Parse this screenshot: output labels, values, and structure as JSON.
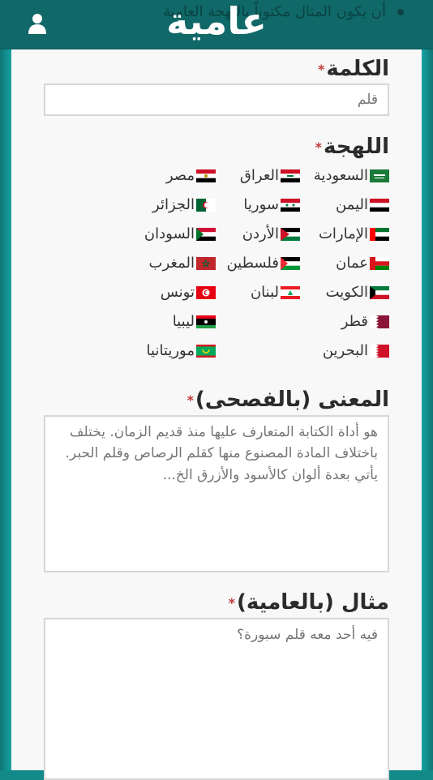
{
  "header": {
    "logo": "عامية",
    "background_text": "أن يكون المثال مكتوباً باللهجة العامية",
    "user_icon": "user-icon"
  },
  "word": {
    "label": "الكلمة",
    "required_mark": "*",
    "placeholder": "قلم"
  },
  "dialect": {
    "label": "اللهجة",
    "required_mark": "*",
    "options": [
      {
        "label": "السعودية",
        "flag": "flag-saudi"
      },
      {
        "label": "العراق",
        "flag": "flag-iraq"
      },
      {
        "label": "مصر",
        "flag": "flag-egypt"
      },
      {
        "label": "اليمن",
        "flag": "flag-yemen"
      },
      {
        "label": "سوريا",
        "flag": "flag-syria"
      },
      {
        "label": "الجزائر",
        "flag": "flag-algeria"
      },
      {
        "label": "الإمارات",
        "flag": "flag-uae"
      },
      {
        "label": "الأردن",
        "flag": "flag-jordan"
      },
      {
        "label": "السودان",
        "flag": "flag-sudan"
      },
      {
        "label": "عمان",
        "flag": "flag-oman"
      },
      {
        "label": "فلسطين",
        "flag": "flag-palestine"
      },
      {
        "label": "المغرب",
        "flag": "flag-morocco"
      },
      {
        "label": "الكويت",
        "flag": "flag-kuwait"
      },
      {
        "label": "لبنان",
        "flag": "flag-lebanon"
      },
      {
        "label": "تونس",
        "flag": "flag-tunisia"
      },
      {
        "label": "قطر",
        "flag": "flag-qatar"
      },
      {
        "label": "ليبيا",
        "flag": "flag-libya"
      },
      {
        "label": "البحرين",
        "flag": "flag-bahrain"
      },
      {
        "label": "موريتانيا",
        "flag": "flag-mauritania"
      }
    ]
  },
  "meaning": {
    "label": "المعنى (بالفصحى)",
    "required_mark": "*",
    "placeholder": "هو أداة الكتابة المتعارف عليها منذ قديم الزمان. يختلف باختلاف المادة المصنوع منها كقلم الرصاص وقلم الحبر. يأتي بعدة ألوان كالأسود والأزرق الخ..."
  },
  "example": {
    "label": "مثال (بالعامية)",
    "required_mark": "*",
    "placeholder": "فيه أحد معه قلم سبورة؟"
  },
  "colors": {
    "header": "#106868",
    "side": "#138a8a",
    "panel": "#f8f8f8",
    "required": "#c23b3b"
  }
}
